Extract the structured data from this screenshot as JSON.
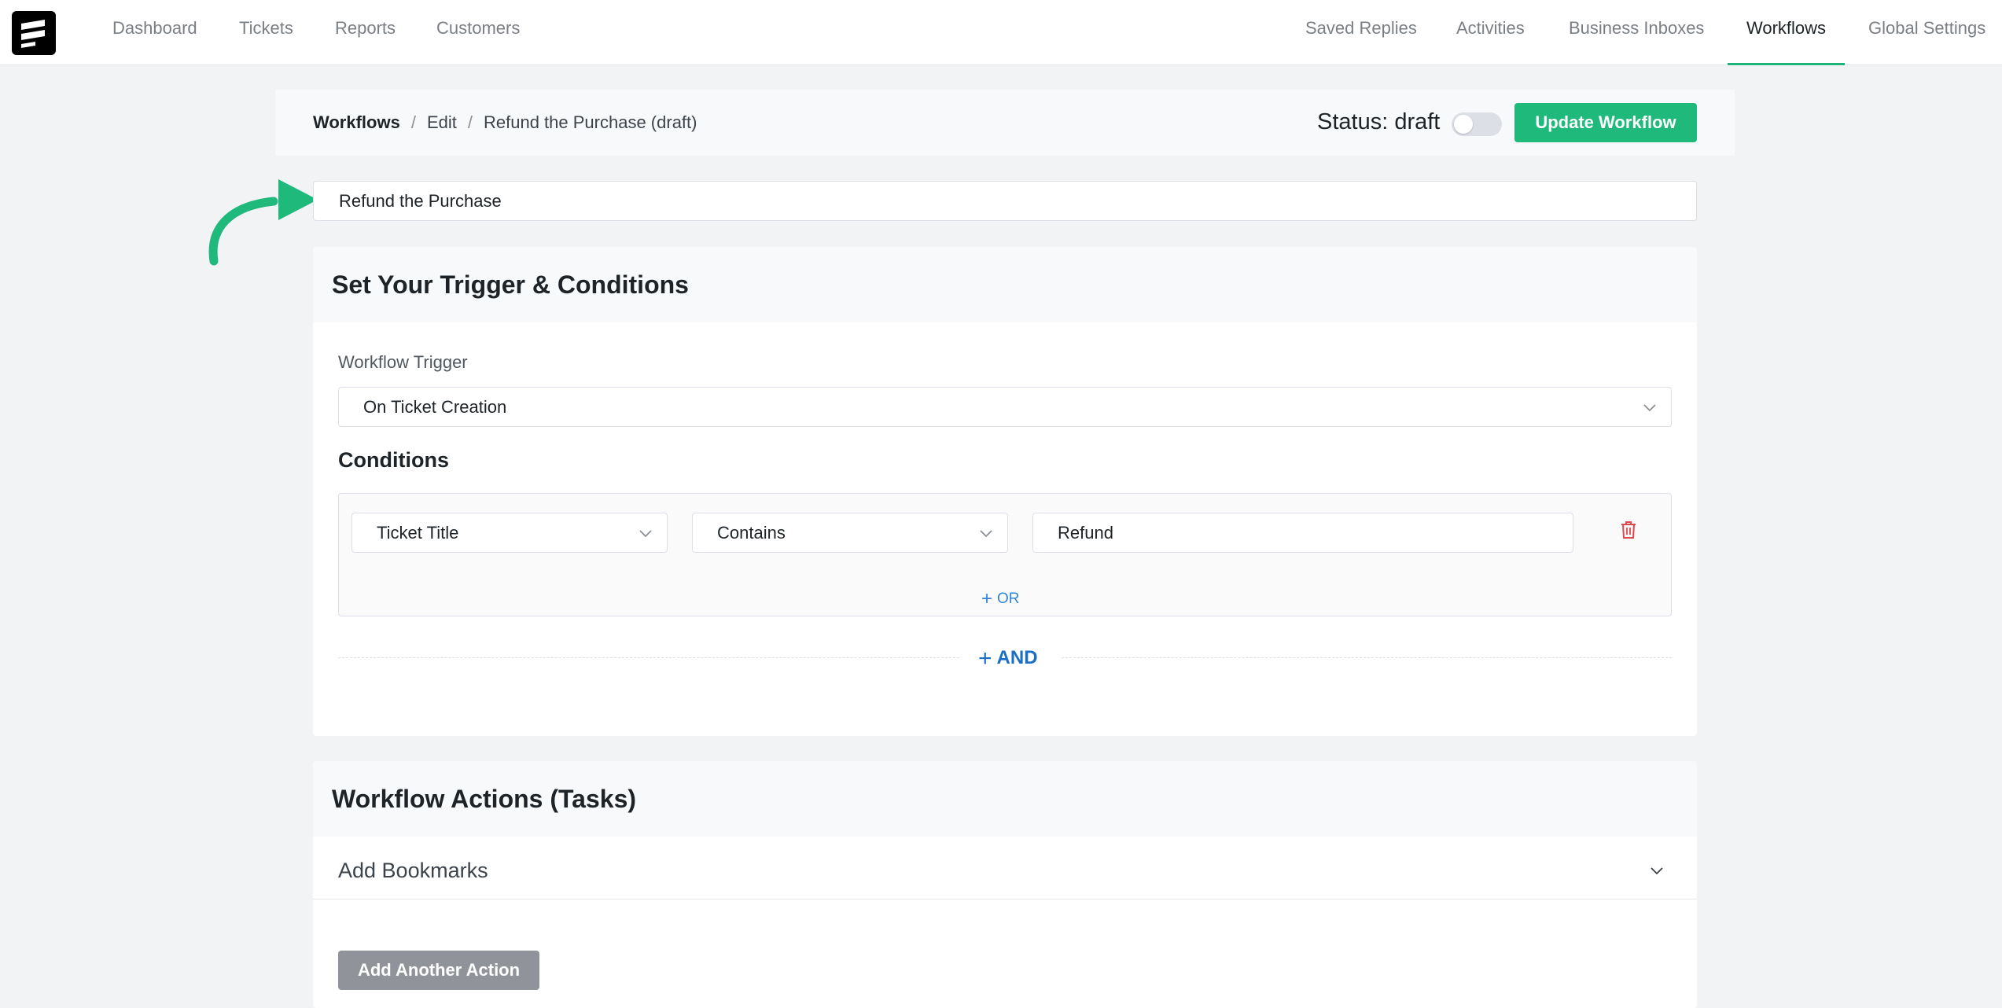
{
  "nav": {
    "left": [
      "Dashboard",
      "Tickets",
      "Reports",
      "Customers"
    ],
    "right": [
      "Saved Replies",
      "Activities",
      "Business Inboxes",
      "Workflows",
      "Global Settings"
    ],
    "active": "Workflows"
  },
  "breadcrumb": {
    "root": "Workflows",
    "edit": "Edit",
    "current": "Refund the Purchase (draft)",
    "separator": "/"
  },
  "status": {
    "label": "Status: draft",
    "toggle_on": false
  },
  "update_button": "Update Workflow",
  "workflow_title_value": "Refund the Purchase",
  "trigger_section": {
    "title": "Set Your Trigger & Conditions",
    "trigger_label": "Workflow Trigger",
    "trigger_value": "On Ticket Creation",
    "conditions_label": "Conditions",
    "condition": {
      "field": "Ticket Title",
      "operator": "Contains",
      "value": "Refund"
    },
    "or_label": "OR",
    "and_label": "AND"
  },
  "actions_section": {
    "title": "Workflow Actions (Tasks)",
    "action_item": "Add Bookmarks",
    "add_another": "Add Another Action"
  },
  "colors": {
    "accent": "#1fb97c",
    "danger": "#e0474c",
    "link": "#1a6fc4",
    "muted_button": "#909399"
  }
}
